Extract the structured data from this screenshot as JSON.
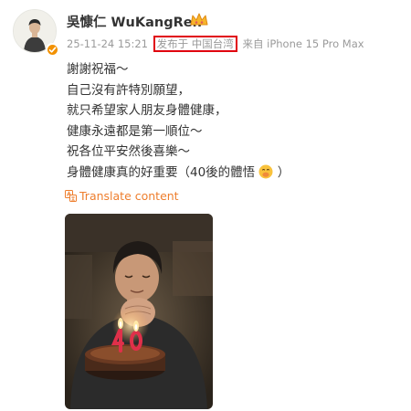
{
  "user": {
    "name": "吳慷仁 WuKangRen",
    "avatar_icon": "user-avatar",
    "verified_icon": "verified-badge-icon",
    "crown_icon": "crown-icon"
  },
  "meta": {
    "timestamp": "25-11-24 15:21",
    "location": "发布于 中国台湾",
    "source": "来自 iPhone 15 Pro Max"
  },
  "post": {
    "lines": [
      "謝謝祝福～",
      "自己沒有許特別願望，",
      "就只希望家人朋友身體健康，",
      "健康永遠都是第一順位～",
      "祝各位平安然後喜樂～",
      "身體健康真的好重要（40後的體悟"
    ],
    "last_line_suffix": "）",
    "emoji": "face-with-hand-over-mouth-emoji"
  },
  "translate": {
    "label": "Translate content",
    "icon": "translate-icon"
  },
  "photo": {
    "icon": "birthday-photo",
    "candle_digits": "40"
  },
  "colors": {
    "highlight_box": "#e0000e",
    "translate": "#ee7e2d",
    "meta_text": "#9a9a9a",
    "verified": "#f29100"
  }
}
